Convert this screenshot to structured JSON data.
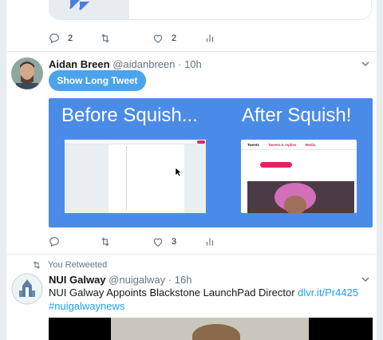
{
  "previous_tweet": {
    "reply_count": "2",
    "like_count": "2"
  },
  "tweet1": {
    "author_name": "Aidan Breen",
    "handle": "@aidanbreen",
    "separator": "·",
    "time": "10h",
    "show_button_label": "Show Long Tweet",
    "media": {
      "caption_before": "Before Squish...",
      "caption_after": "After Squish!",
      "after_tabs": [
        "Tweets",
        "Tweets & replies",
        "Media"
      ]
    },
    "like_count": "3"
  },
  "tweet2": {
    "retweet_context": "You Retweeted",
    "author_name": "NUI Galway",
    "handle": "@nuigalway",
    "separator": "·",
    "time": "16h",
    "text": "NUI Galway Appoints Blackstone LaunchPad Director ",
    "link": "dlvr.it/Pr4425",
    "hashtag": "#nuigalwaynews"
  },
  "colors": {
    "accent": "#1da1f2",
    "button": "#4ba3eb",
    "media_bg": "#4a8be8",
    "muted": "#657786",
    "like_pink": "#e0245e"
  },
  "icons": [
    "reply-icon",
    "retweet-icon",
    "like-icon",
    "analytics-icon",
    "chevron-down-icon",
    "retweeted-icon"
  ]
}
